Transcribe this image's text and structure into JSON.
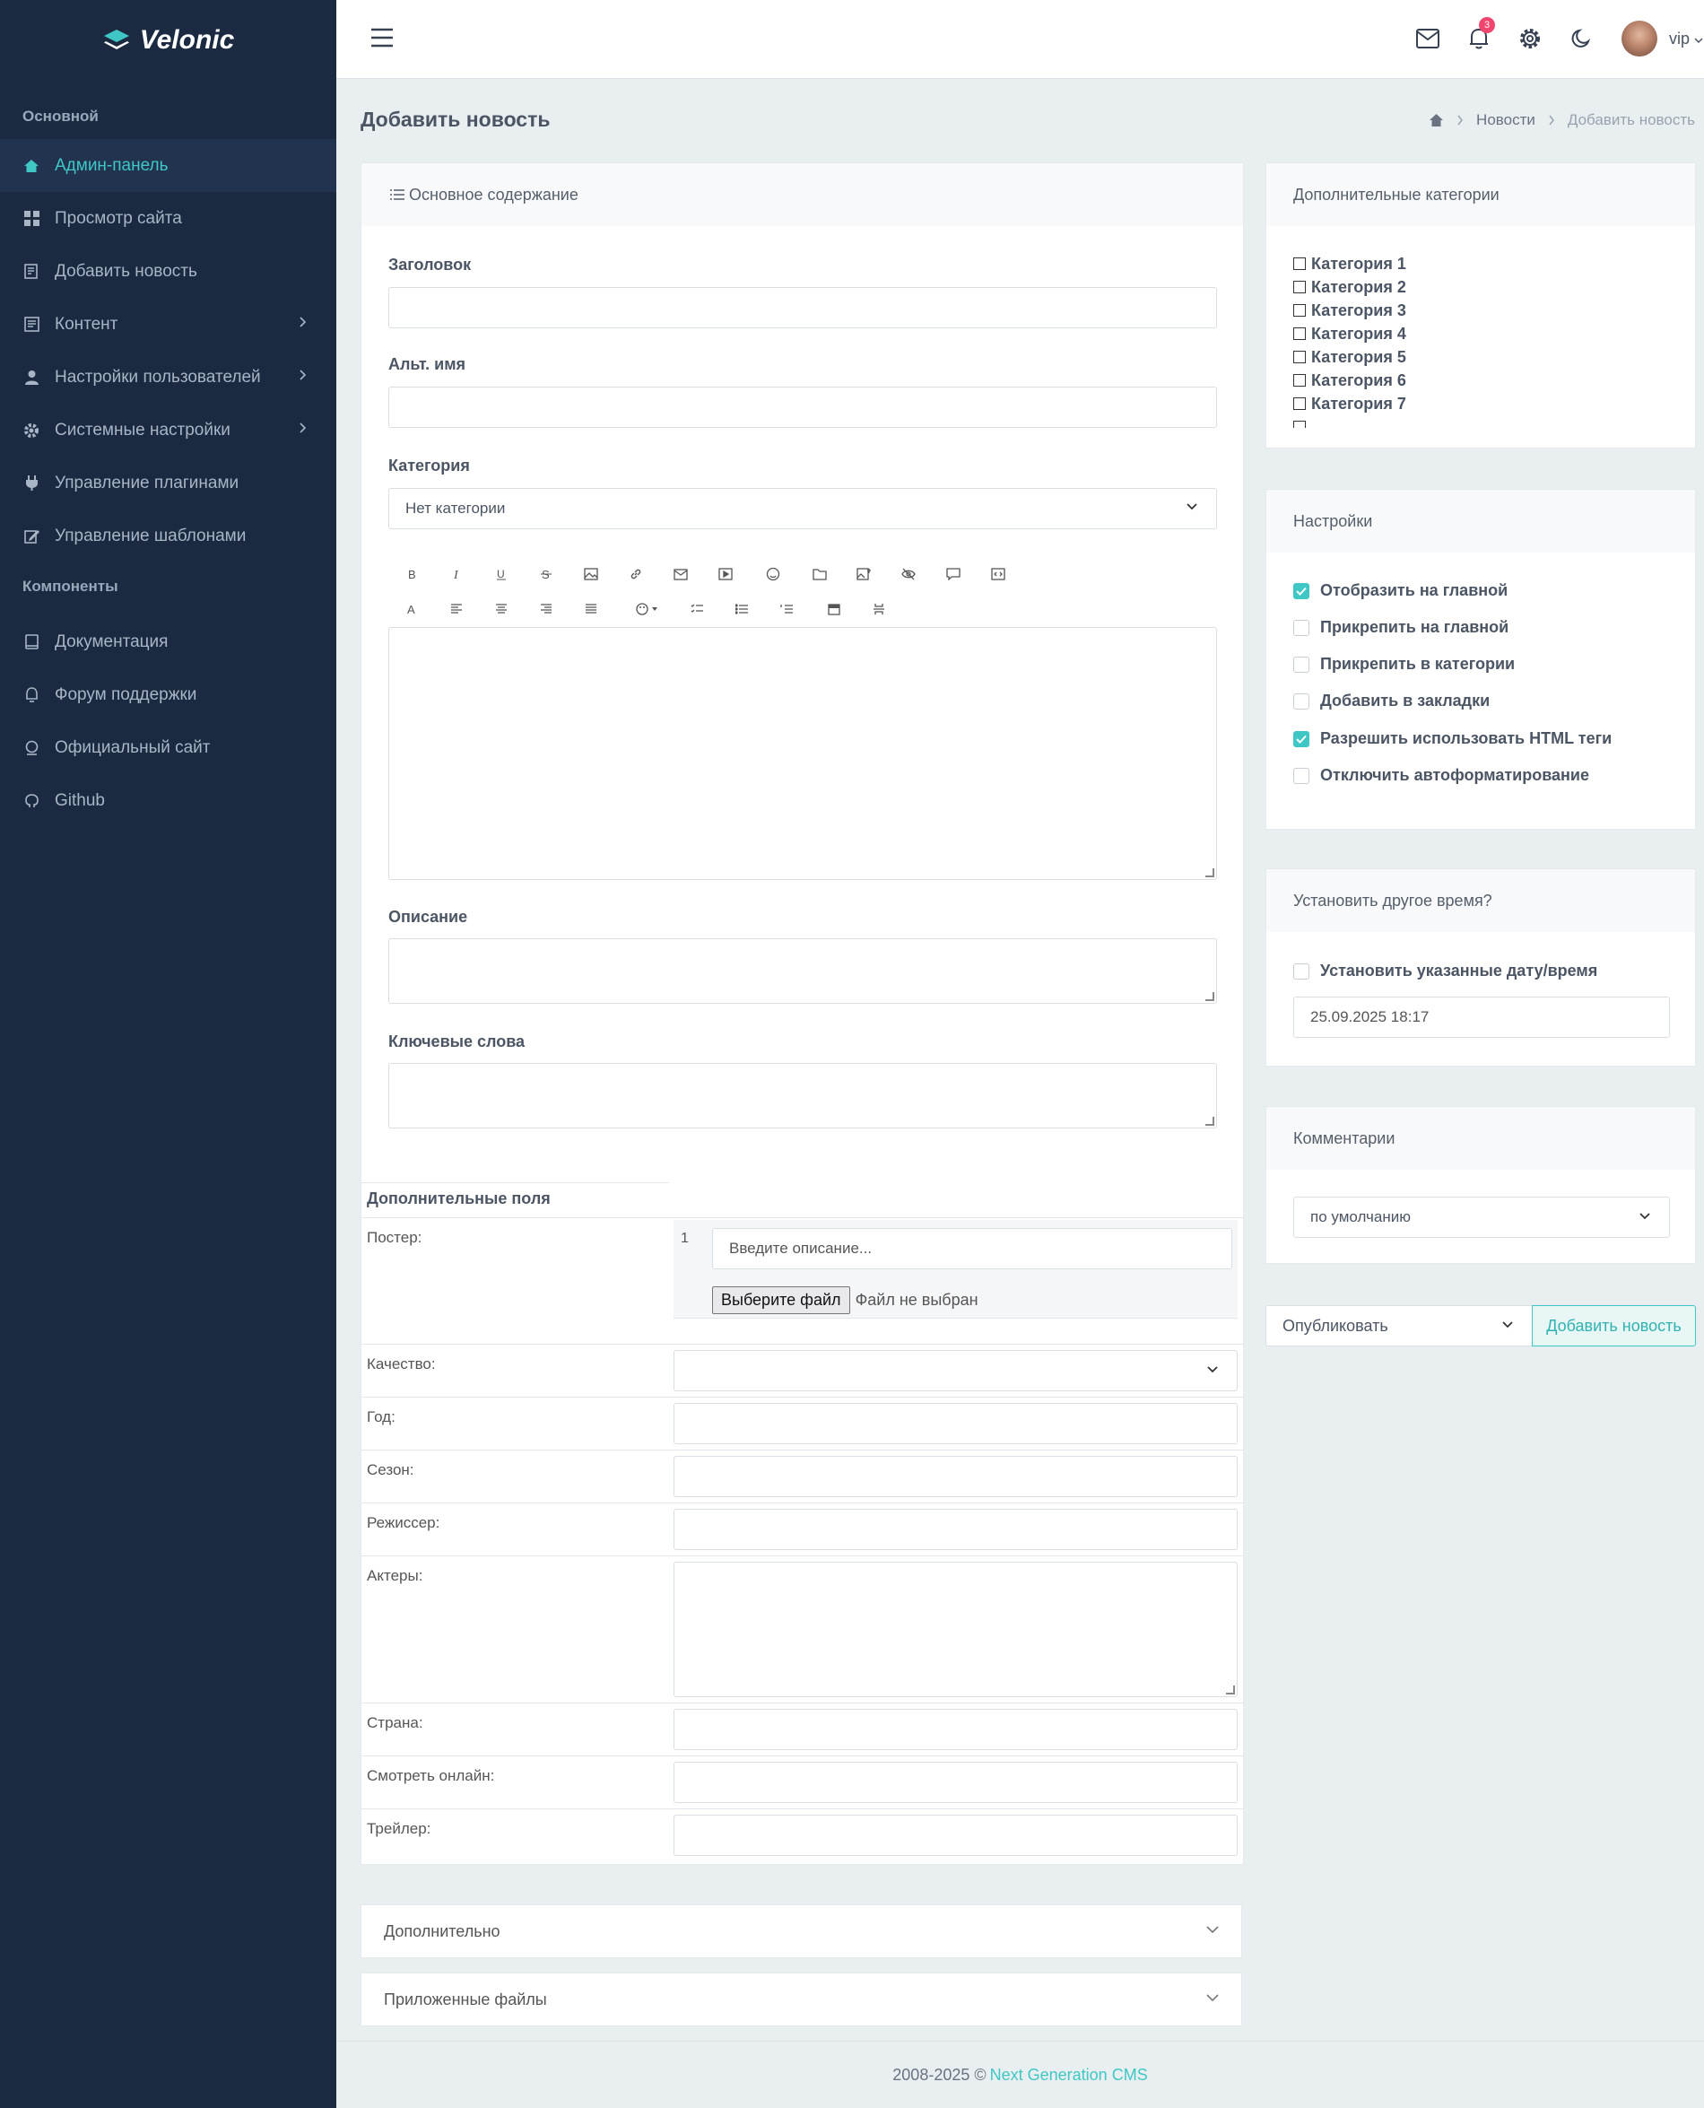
{
  "brand": "Velonic",
  "sidebar": {
    "sections": [
      {
        "title": "Основной",
        "items": [
          {
            "label": "Админ-панель",
            "active": true
          },
          {
            "label": "Просмотр сайта"
          },
          {
            "label": "Добавить новость"
          },
          {
            "label": "Контент",
            "has_children": true
          },
          {
            "label": "Настройки пользователей",
            "has_children": true
          },
          {
            "label": "Системные настройки",
            "has_children": true
          },
          {
            "label": "Управление плагинами"
          },
          {
            "label": "Управление шаблонами"
          }
        ]
      },
      {
        "title": "Компоненты",
        "items": [
          {
            "label": "Документация"
          },
          {
            "label": "Форум поддержки"
          },
          {
            "label": "Официальный сайт"
          },
          {
            "label": "Github"
          }
        ]
      }
    ]
  },
  "topbar": {
    "notifications_count": "3",
    "user": "vip"
  },
  "page": {
    "title": "Добавить новость",
    "breadcrumb": [
      "Новости",
      "Добавить новость"
    ]
  },
  "main_card": {
    "header": "Основное содержание",
    "title_label": "Заголовок",
    "alt_label": "Альт. имя",
    "category_label": "Категория",
    "category_value": "Нет категории",
    "description_label": "Описание",
    "keywords_label": "Ключевые слова",
    "extra_fields_title": "Дополнительные поля",
    "poster_label": "Постер:",
    "poster_index": "1",
    "poster_placeholder": "Введите описание...",
    "file_button": "Выберите файл",
    "file_status": "Файл не выбран",
    "fields": [
      "Качество:",
      "Год:",
      "Сезон:",
      "Режиссер:",
      "Актеры:",
      "Страна:",
      "Смотреть онлайн:",
      "Трейлер:"
    ]
  },
  "accordions": [
    "Дополнительно",
    "Приложенные файлы"
  ],
  "extra_categories": {
    "header": "Дополнительные категории",
    "items": [
      "Категория 1",
      "Категория 2",
      "Категория 3",
      "Категория 4",
      "Категория 5",
      "Категория 6",
      "Категория 7"
    ]
  },
  "settings": {
    "header": "Настройки",
    "options": [
      {
        "label": "Отобразить на главной",
        "checked": true
      },
      {
        "label": "Прикрепить на главной",
        "checked": false
      },
      {
        "label": "Прикрепить в категории",
        "checked": false
      },
      {
        "label": "Добавить в закладки",
        "checked": false
      },
      {
        "label": "Разрешить использовать HTML теги",
        "checked": true
      },
      {
        "label": "Отключить автоформатирование",
        "checked": false
      }
    ]
  },
  "time_card": {
    "header": "Установить другое время?",
    "checkbox_label": "Установить указанные дату/время",
    "datetime": "25.09.2025 18:17"
  },
  "comments_card": {
    "header": "Комментарии",
    "value": "по умолчанию"
  },
  "publish": {
    "status": "Опубликовать",
    "button": "Добавить новость"
  },
  "footer": {
    "text": "2008-2025 ©",
    "link": "Next Generation CMS"
  },
  "colors": {
    "accent": "#3ec7c5",
    "sidebar": "#1b2a41",
    "badge": "#f0456e"
  }
}
